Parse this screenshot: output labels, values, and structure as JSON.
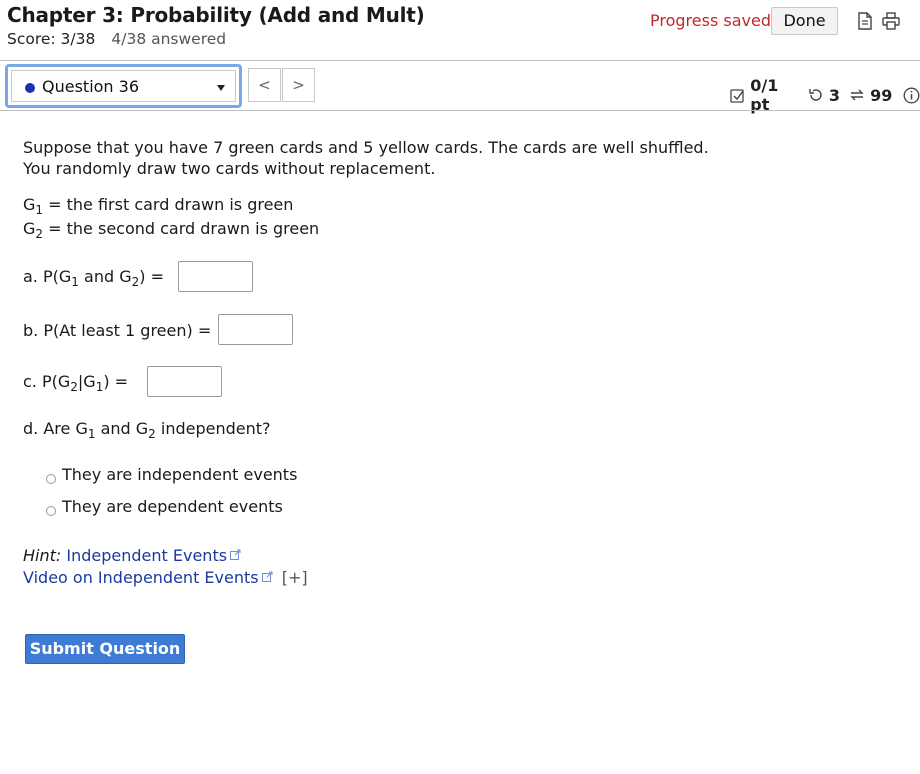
{
  "header": {
    "title": "Chapter 3: Probability (Add and Mult)",
    "score": "Score: 3/38",
    "answered": "4/38 answered",
    "progress_saved": "Progress saved",
    "done_label": "Done",
    "icons": [
      "document-icon",
      "print-icon"
    ]
  },
  "nav": {
    "question_label": "Question 36",
    "prev_label": "<",
    "next_label": ">"
  },
  "status": {
    "points": "0/1 pt",
    "retries": "3",
    "attempts": "99",
    "colors": {
      "accent": "#3d7bd4",
      "alert": "#c1272d",
      "link": "#1a3a9e",
      "dot": "#1f2fb0"
    }
  },
  "question": {
    "stem_line1": "Suppose that you have 7 green cards and 5 yellow cards. The cards are well shuffled.",
    "stem_line2": "You randomly draw two cards without replacement.",
    "g1_def": "= the first card drawn is green",
    "g2_def": "= the second card drawn is green",
    "G": "G",
    "one": "1",
    "two": "2",
    "part_a_prefix": "a.  P(",
    "part_a_and": " and ",
    "part_a_suffix": ") =",
    "part_b": "b.  P(At least 1 green) =",
    "part_c_prefix": "c.  P(",
    "part_c_bar": "|",
    "part_c_suffix": ") =",
    "part_d_prefix": "d.  Are ",
    "part_d_and": " and ",
    "part_d_suffix": " independent?",
    "options": [
      "They are independent events",
      "They are dependent events"
    ],
    "answers": {
      "a": "",
      "b": "",
      "c": ""
    }
  },
  "hint": {
    "label": "Hint:",
    "link1": "Independent Events",
    "link2": "Video on Independent Events",
    "expand": "[+]"
  },
  "submit_label": "Submit Question"
}
